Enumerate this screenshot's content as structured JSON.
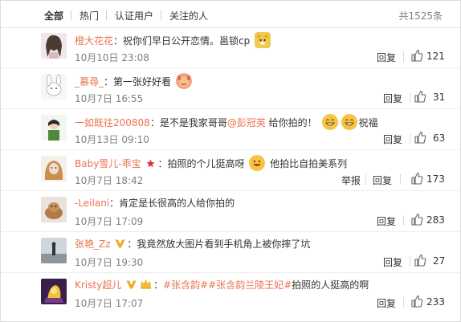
{
  "tabs": [
    "全部",
    "热门",
    "认证用户",
    "关注的人"
  ],
  "total_text": "共1525条",
  "reply_label": "回复",
  "report_label": "举报",
  "colors": {
    "link": "#eb7350",
    "muted": "#808080",
    "verified_gold": "#f5a623",
    "star_red": "#e0342e"
  },
  "comments": [
    {
      "user": "橙大花花",
      "colon": "：",
      "text1": "祝你们早日公开恋情。邕锁cp",
      "time": "10月10日 23:08",
      "likes": "121"
    },
    {
      "user": "_慕尋_",
      "colon": "：",
      "text1": "第一张好好看",
      "time": "10月7日 16:55",
      "likes": "31"
    },
    {
      "user": "一如既往200808",
      "colon": "：",
      "text1": "是不是我家哥哥",
      "mention": "@彭冠英",
      "text2": " 给你拍的！",
      "text3": "祝福",
      "time": "10月13日 09:10",
      "likes": "63"
    },
    {
      "user": "Baby雪儿-乖宝",
      "colon": "：",
      "text1": "拍照的个儿挺高呀",
      "text2": " 他拍比自拍美系列",
      "time": "10月7日 18:42",
      "likes": "173"
    },
    {
      "user": "-Leilani",
      "colon": "：",
      "text1": "肯定是长很高的人给你拍的",
      "time": "10月7日 17:09",
      "likes": "283"
    },
    {
      "user": "张艳_Zz",
      "colon": "：",
      "text1": "我竟然放大图片看到手机角上被你摔了坑",
      "time": "10月7日 19:30",
      "likes": "27"
    },
    {
      "user": "Kristy超儿",
      "colon": "：",
      "topic1": "#张含韵#",
      "topic2": "#张含韵兰陵王妃#",
      "text1": "拍照的人挺高的啊",
      "time": "10月7日 17:07",
      "likes": "233"
    }
  ]
}
